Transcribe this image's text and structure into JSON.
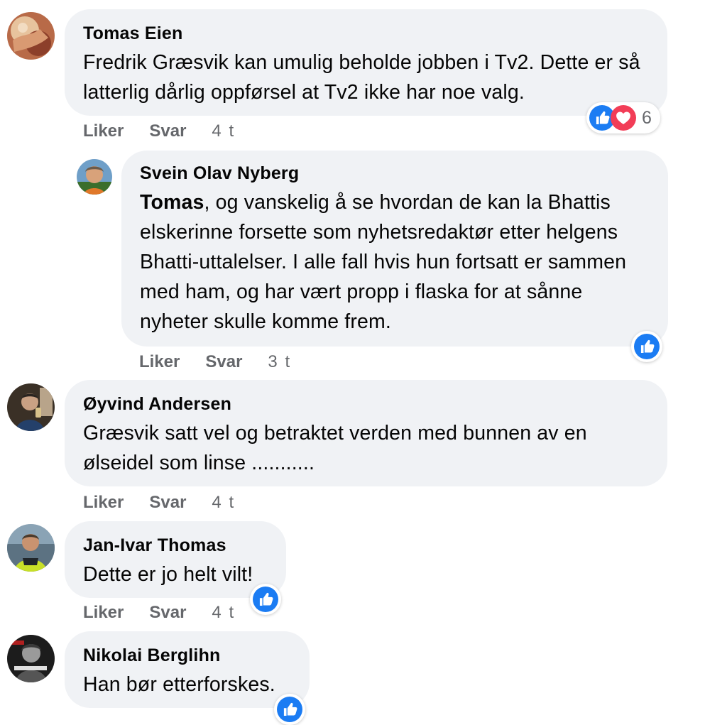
{
  "colors": {
    "bubble": "#f0f2f5",
    "meta_text": "#65676b",
    "like_blue": "#1877f2",
    "love_red": "#f33e58"
  },
  "comments": [
    {
      "author": "Tomas Eien",
      "text": "Fredrik Græsvik kan umulig beholde jobben i Tv2. Dette er så latterlig dårlig oppførsel at Tv2 ikke har noe valg.",
      "actions": {
        "like": "Liker",
        "reply": "Svar",
        "time": "4 t"
      },
      "reactions": {
        "icons": [
          "like-icon",
          "love-icon"
        ],
        "count": "6"
      }
    },
    {
      "author": "Svein Olav Nyberg",
      "mention": "Tomas",
      "text": ", og vanskelig å se hvordan de kan la Bhattis elskerinne forsette som nyhetsredaktør etter helgens Bhatti-uttalelser. I alle fall hvis hun fortsatt er sammen med ham, og har vært propp i flaska for at sånne nyheter skulle komme frem.",
      "actions": {
        "like": "Liker",
        "reply": "Svar",
        "time": "3 t"
      },
      "reactions": {
        "icons": [
          "like-icon"
        ]
      }
    },
    {
      "author": "Øyvind Andersen",
      "text": "Græsvik satt vel og betraktet verden med bunnen av en ølseidel som linse ...........",
      "actions": {
        "like": "Liker",
        "reply": "Svar",
        "time": "4 t"
      }
    },
    {
      "author": "Jan-Ivar Thomas",
      "text": "Dette er jo helt vilt!",
      "actions": {
        "like": "Liker",
        "reply": "Svar",
        "time": "4 t"
      },
      "reactions": {
        "icons": [
          "like-icon"
        ]
      }
    },
    {
      "author": "Nikolai Berglihn",
      "text": "Han bør etterforskes.",
      "reactions": {
        "icons": [
          "like-icon"
        ]
      }
    }
  ]
}
